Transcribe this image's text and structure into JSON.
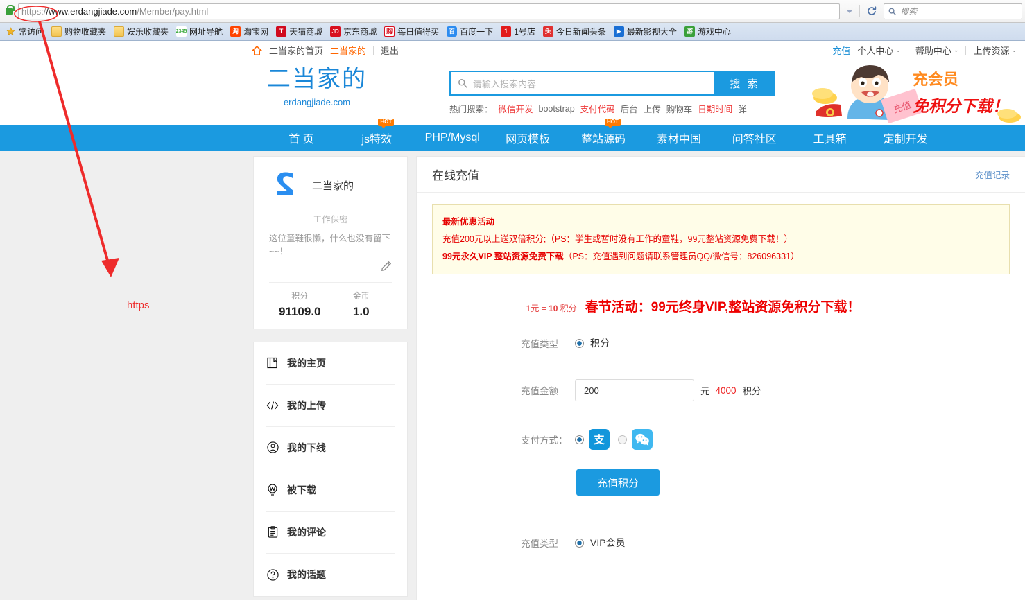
{
  "browser": {
    "url_scheme": "https:/",
    "url_host": "/www.erdangjiade.com",
    "url_path": "/Member/pay.html",
    "url_full": "https://www.erdangjiade.com/Member/pay.html",
    "search_placeholder": "搜索",
    "lock_icon": "lock-icon",
    "reload_icon": "reload-icon",
    "dropdown_icon": "chevron-down-icon",
    "bookmarks": [
      {
        "label": "常访问",
        "icon": "star-icon",
        "icon_class": ""
      },
      {
        "label": "购物收藏夹",
        "icon": "folder-icon",
        "icon_class": "ico-folder",
        "glyph": ""
      },
      {
        "label": "娱乐收藏夹",
        "icon": "folder-icon",
        "icon_class": "ico-folder",
        "glyph": ""
      },
      {
        "label": "网址导航",
        "icon": "2345-icon",
        "icon_class": "ico-2345",
        "glyph": "2345"
      },
      {
        "label": "淘宝网",
        "icon": "taobao-icon",
        "icon_class": "ico-taobao",
        "glyph": "淘"
      },
      {
        "label": "天猫商城",
        "icon": "tmall-icon",
        "icon_class": "ico-tmall",
        "glyph": "T"
      },
      {
        "label": "京东商城",
        "icon": "jd-icon",
        "icon_class": "ico-jd",
        "glyph": "JD"
      },
      {
        "label": "每日值得买",
        "icon": "gou-icon",
        "icon_class": "ico-gou",
        "glyph": "购"
      },
      {
        "label": "百度一下",
        "icon": "baidu-icon",
        "icon_class": "ico-baidu",
        "glyph": "百"
      },
      {
        "label": "1号店",
        "icon": "yihaodian-icon",
        "icon_class": "ico-yihao",
        "glyph": "1"
      },
      {
        "label": "今日新闻头条",
        "icon": "toutiao-icon",
        "icon_class": "ico-tou",
        "glyph": "头"
      },
      {
        "label": "最新影视大全",
        "icon": "video-icon",
        "icon_class": "ico-video",
        "glyph": "▶"
      },
      {
        "label": "游戏中心",
        "icon": "game-icon",
        "icon_class": "ico-game",
        "glyph": "游"
      }
    ]
  },
  "topbar": {
    "home_label": "二当家的首页",
    "user_label": "二当家的",
    "logout_label": "退出",
    "right_items": [
      {
        "label": "充值",
        "has_caret": false
      },
      {
        "label": "个人中心",
        "has_caret": true
      },
      {
        "label": "帮助中心",
        "has_caret": true
      },
      {
        "label": "上传资源",
        "has_caret": true
      }
    ]
  },
  "header": {
    "logo_main": "二当家的",
    "logo_sub": "erdangjiade.com",
    "search_placeholder": "请输入搜索内容",
    "search_button": "搜 索",
    "hot_label": "热门搜索：",
    "hot_keywords": [
      {
        "text": "微信开发",
        "red": true
      },
      {
        "text": "bootstrap",
        "red": false
      },
      {
        "text": "支付代码",
        "red": true
      },
      {
        "text": "后台",
        "red": false
      },
      {
        "text": "上传",
        "red": false
      },
      {
        "text": "购物车",
        "red": false
      },
      {
        "text": "日期时间",
        "red": true
      },
      {
        "text": "弹",
        "red": false
      }
    ],
    "banner_line1": "充会员",
    "banner_line2": "免积分下载！",
    "banner_coupon_text": "充值"
  },
  "mainnav": {
    "items": [
      {
        "label": "首 页",
        "hot": false
      },
      {
        "label": "js特效",
        "hot": true,
        "badge": "HOT"
      },
      {
        "label": "PHP/Mysql",
        "hot": false
      },
      {
        "label": "网页模板",
        "hot": false
      },
      {
        "label": "整站源码",
        "hot": true,
        "badge": "HOT"
      },
      {
        "label": "素材中国",
        "hot": false
      },
      {
        "label": "问答社区",
        "hot": false
      },
      {
        "label": "工具箱",
        "hot": false
      },
      {
        "label": "定制开发",
        "hot": false
      }
    ]
  },
  "profile": {
    "avatar_glyph": "2",
    "name": "二当家的",
    "job": "工作保密",
    "bio": "这位童鞋很懒，什么也没有留下~~！",
    "edit_icon": "pencil-icon",
    "stats": [
      {
        "label": "积分",
        "value": "91109.0"
      },
      {
        "label": "金币",
        "value": "1.0"
      }
    ]
  },
  "sidebar": {
    "items": [
      {
        "label": "我的主页",
        "icon": "book-icon"
      },
      {
        "label": "我的上传",
        "icon": "code-icon"
      },
      {
        "label": "我的下线",
        "icon": "user-circle-icon"
      },
      {
        "label": "被下载",
        "icon": "lightbulb-icon"
      },
      {
        "label": "我的评论",
        "icon": "clipboard-icon"
      },
      {
        "label": "我的话题",
        "icon": "question-circle-icon"
      }
    ]
  },
  "panel": {
    "title": "在线充值",
    "record_link": "充值记录",
    "promo": {
      "heading": "最新优惠活动",
      "line2": "充值200元以上送双倍积分;（PS：学生或暂时没有工作的童鞋，99元整站资源免费下载！）",
      "line3_bold": "99元永久VIP 整站资源免费下载",
      "line3_rest": "（PS：充值遇到问题请联系管理员QQ/微信号：826096331）"
    },
    "rate_note_pre": "1元 = ",
    "rate_note_num": "10",
    "rate_note_post": " 积分",
    "festival_text": "春节活动：99元终身VIP,整站资源免积分下载！",
    "form": {
      "type_label": "充值类型",
      "type_option_points": "积分",
      "amount_label": "充值金额",
      "amount_value": "200",
      "amount_unit": "元",
      "amount_points": "4000",
      "amount_points_unit": "积分",
      "pay_label": "支付方式：",
      "pay_alipay": "alipay-icon",
      "pay_wechat": "wechat-icon",
      "submit_label": "充值积分",
      "type_label2": "充值类型",
      "type_option_vip": "VIP会员"
    }
  },
  "annotation": {
    "label": "https",
    "color": "#ee2b2b",
    "ellipse_name": "url-scheme-highlight",
    "arrow_name": "annotation-arrow"
  }
}
